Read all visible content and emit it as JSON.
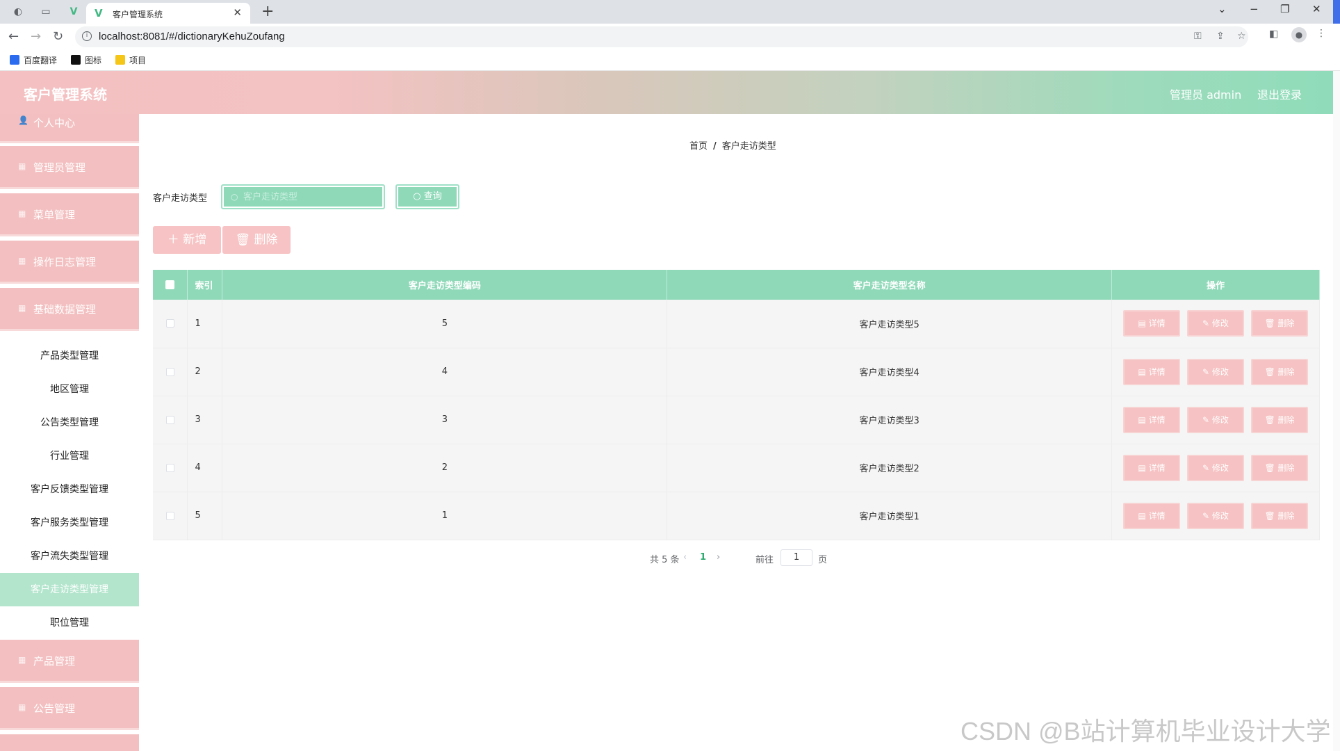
{
  "browser": {
    "tab_title": "客户管理系统",
    "url": "localhost:8081/#/dictionaryKehuZoufang",
    "bookmarks": [
      {
        "label": "百度翻译",
        "color": "#2a6bf0"
      },
      {
        "label": "图标",
        "color": "#111111"
      },
      {
        "label": "项目",
        "color": "#f5c518"
      }
    ]
  },
  "header": {
    "title": "客户管理系统",
    "admin_label": "管理员 admin",
    "logout_label": "退出登录"
  },
  "sidebar": {
    "main_items": [
      {
        "label": "个人中心",
        "icon": "user-icon"
      },
      {
        "label": "管理员管理",
        "icon": "menu-icon"
      },
      {
        "label": "菜单管理",
        "icon": "menu-icon"
      },
      {
        "label": "操作日志管理",
        "icon": "menu-icon"
      },
      {
        "label": "基础数据管理",
        "icon": "menu-icon"
      },
      {
        "label": "产品管理",
        "icon": "menu-icon"
      },
      {
        "label": "公告管理",
        "icon": "menu-icon"
      }
    ],
    "sub_items": [
      {
        "label": "产品类型管理"
      },
      {
        "label": "地区管理"
      },
      {
        "label": "公告类型管理"
      },
      {
        "label": "行业管理"
      },
      {
        "label": "客户反馈类型管理"
      },
      {
        "label": "客户服务类型管理"
      },
      {
        "label": "客户流失类型管理"
      },
      {
        "label": "客户走访类型管理",
        "active": true
      },
      {
        "label": "职位管理"
      }
    ]
  },
  "breadcrumb": {
    "home": "首页",
    "separator": "/",
    "current": "客户走访类型"
  },
  "filter": {
    "label": "客户走访类型",
    "placeholder": "客户走访类型",
    "query_label": "查询"
  },
  "actions": {
    "add_label": "新增",
    "delete_label": "删除"
  },
  "table": {
    "headers": {
      "index": "索引",
      "code": "客户走访类型编码",
      "name": "客户走访类型名称",
      "ops": "操作"
    },
    "row_buttons": {
      "detail": "详情",
      "edit": "修改",
      "delete": "删除"
    },
    "rows": [
      {
        "index": "1",
        "code": "5",
        "name": "客户走访类型5"
      },
      {
        "index": "2",
        "code": "4",
        "name": "客户走访类型4"
      },
      {
        "index": "3",
        "code": "3",
        "name": "客户走访类型3"
      },
      {
        "index": "4",
        "code": "2",
        "name": "客户走访类型2"
      },
      {
        "index": "5",
        "code": "1",
        "name": "客户走访类型1"
      }
    ]
  },
  "pagination": {
    "total_text": "共 5 条",
    "current_page": "1",
    "goto_label": "前往",
    "goto_value": "1",
    "page_suffix": "页"
  },
  "watermark": "CSDN @B站计算机毕业设计大学",
  "colors": {
    "pink": "#f3bfc0",
    "green": "#8fd9b9",
    "active_sub": "#b3e5cd"
  }
}
